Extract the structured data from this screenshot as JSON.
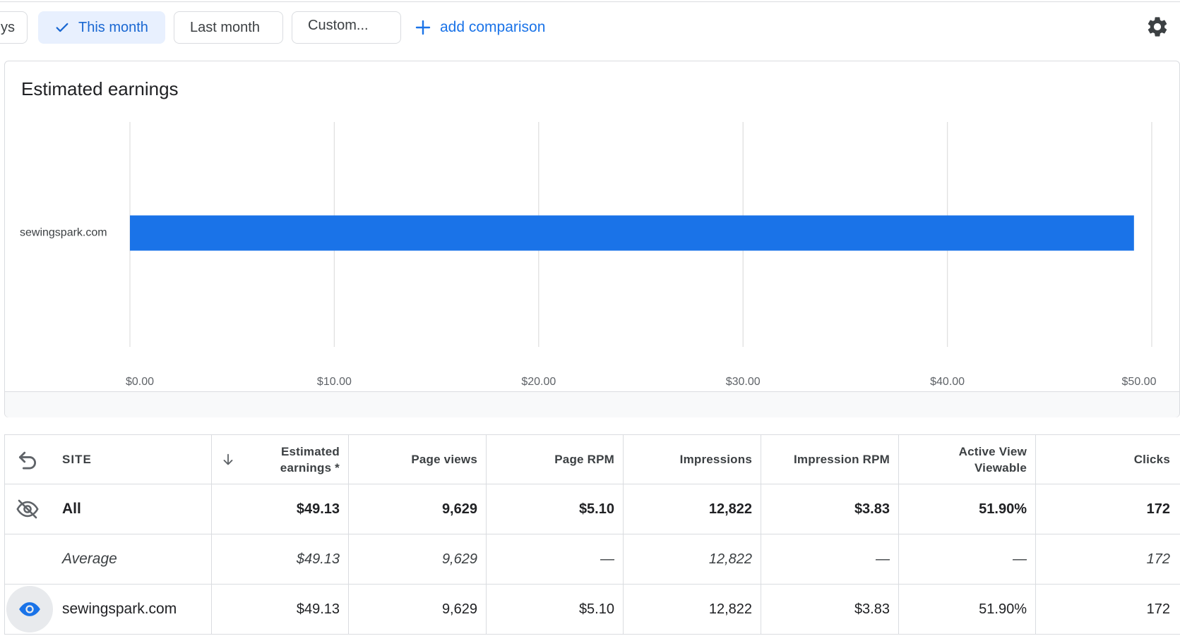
{
  "filters": {
    "partial_chip": "ys",
    "this_month": "This month",
    "last_month": "Last month",
    "custom": "Custom...",
    "add_comparison": "add comparison"
  },
  "icons": {
    "check": "check-icon",
    "plus": "plus-icon",
    "settings": "gear-icon",
    "undo": "undo-icon",
    "sort": "arrow-down-icon",
    "hidden": "eye-off-icon",
    "visible": "eye-icon"
  },
  "colors": {
    "accent": "#1a73e8",
    "bar": "#1a73e8",
    "selected_chip_bg": "#e8f0fe"
  },
  "chart_data": {
    "type": "bar",
    "orientation": "horizontal",
    "title": "Estimated earnings",
    "categories": [
      "sewingspark.com"
    ],
    "values": [
      49.13
    ],
    "xlim": [
      0,
      50
    ],
    "xticks": [
      "$0.00",
      "$10.00",
      "$20.00",
      "$30.00",
      "$40.00",
      "$50.00"
    ],
    "grid": true
  },
  "table": {
    "headers": {
      "site": "SITE",
      "estimated_earnings_line1": "Estimated",
      "estimated_earnings_line2": "earnings *",
      "page_views": "Page views",
      "page_rpm": "Page RPM",
      "impressions": "Impressions",
      "impression_rpm": "Impression RPM",
      "active_view_line1": "Active View",
      "active_view_line2": "Viewable",
      "clicks": "Clicks"
    },
    "rows": [
      {
        "site": "All",
        "earnings": "$49.13",
        "page_views": "9,629",
        "page_rpm": "$5.10",
        "impressions": "12,822",
        "impression_rpm": "$3.83",
        "active_view": "51.90%",
        "clicks": "172"
      },
      {
        "site": "Average",
        "earnings": "$49.13",
        "page_views": "9,629",
        "page_rpm": "—",
        "impressions": "12,822",
        "impression_rpm": "—",
        "active_view": "—",
        "clicks": "172"
      },
      {
        "site": "sewingspark.com",
        "earnings": "$49.13",
        "page_views": "9,629",
        "page_rpm": "$5.10",
        "impressions": "12,822",
        "impression_rpm": "$3.83",
        "active_view": "51.90%",
        "clicks": "172"
      }
    ]
  }
}
